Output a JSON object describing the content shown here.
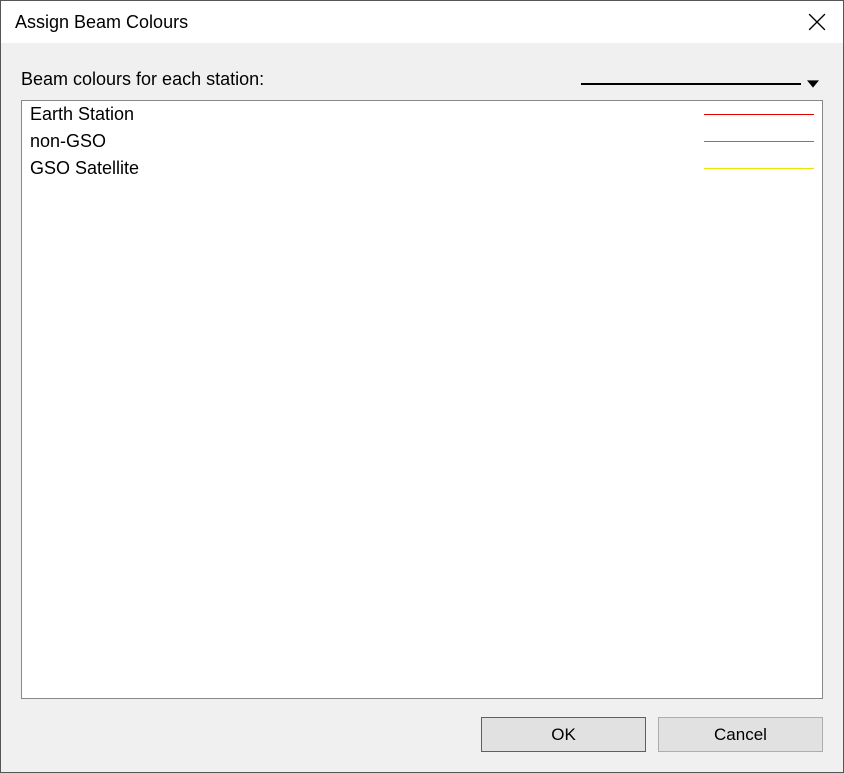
{
  "dialog": {
    "title": "Assign Beam Colours",
    "header_label": "Beam colours for each station:",
    "line_picker_colour": "#000000"
  },
  "stations": [
    {
      "name": "Earth Station",
      "colour": "#e60000"
    },
    {
      "name": "non-GSO",
      "colour": "#00cc00"
    },
    {
      "name": "GSO Satellite",
      "colour": "#e6e600"
    }
  ],
  "buttons": {
    "ok": "OK",
    "cancel": "Cancel"
  }
}
